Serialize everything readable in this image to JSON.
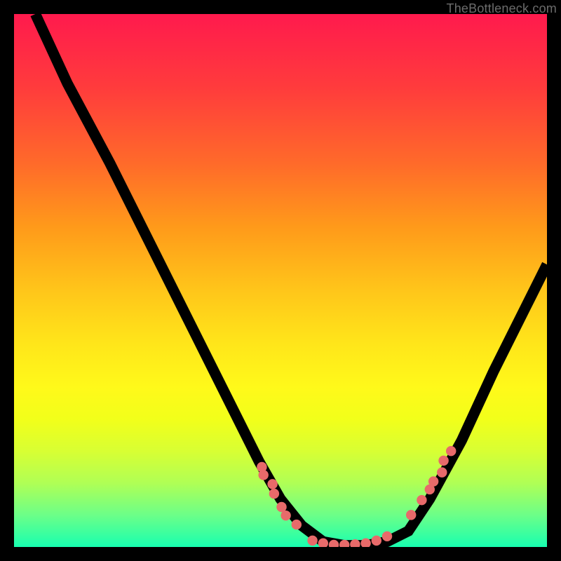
{
  "attribution": "TheBottleneck.com",
  "chart_data": {
    "type": "line",
    "title": "",
    "xlabel": "",
    "ylabel": "",
    "xlim": [
      0,
      100
    ],
    "ylim": [
      0,
      100
    ],
    "series": [
      {
        "name": "curve",
        "x": [
          4,
          10,
          18,
          26,
          34,
          40,
          46,
          50,
          54,
          58,
          62,
          66,
          70,
          74,
          78,
          84,
          90,
          96,
          100
        ],
        "y": [
          100,
          87,
          72,
          56,
          40,
          28,
          16,
          9,
          4,
          1,
          0.3,
          0.3,
          1,
          3,
          9,
          20,
          33,
          45,
          53
        ]
      },
      {
        "name": "dots-left",
        "x": [
          46.5,
          46.8,
          48.5,
          48.8,
          50.2,
          51.0,
          53.0
        ],
        "y": [
          15.0,
          13.5,
          11.8,
          10.0,
          7.5,
          5.9,
          4.2
        ]
      },
      {
        "name": "dots-bottom",
        "x": [
          56.0,
          58.0,
          60.0,
          62.0,
          64.0,
          66.0,
          68.0,
          70.0
        ],
        "y": [
          1.2,
          0.7,
          0.4,
          0.4,
          0.5,
          0.7,
          1.2,
          2.0
        ]
      },
      {
        "name": "dots-right",
        "x": [
          74.5,
          76.5,
          78.0,
          78.7,
          80.3,
          80.6,
          82.0
        ],
        "y": [
          6.0,
          8.8,
          10.8,
          12.3,
          14.0,
          16.2,
          18.0
        ]
      }
    ],
    "colors": {
      "curve": "#000000",
      "dots": "#e86a6a",
      "gradient_top": "#ff1a4d",
      "gradient_bottom": "#18ffb0"
    }
  }
}
